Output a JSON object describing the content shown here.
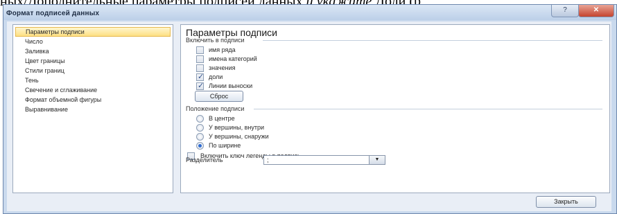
{
  "document": {
    "text_before": "ных/Дополнительные параметры подписей данных ",
    "text_italic": "и укажите",
    "text_after": " Доли (р"
  },
  "window": {
    "title": "Формат подписей данных",
    "help_button": "?",
    "close_button": "✕"
  },
  "sidebar": {
    "items": [
      {
        "label": "Параметры подписи",
        "selected": true
      },
      {
        "label": "Число"
      },
      {
        "label": "Заливка"
      },
      {
        "label": "Цвет границы"
      },
      {
        "label": "Стили границ"
      },
      {
        "label": "Тень"
      },
      {
        "label": "Свечение и сглаживание"
      },
      {
        "label": "Формат объемной фигуры"
      },
      {
        "label": "Выравнивание"
      }
    ]
  },
  "panel": {
    "title": "Параметры подписи",
    "include_section": "Включить в подписи",
    "checkboxes": [
      {
        "label": "имя ряда",
        "checked": false
      },
      {
        "label": "имена категорий",
        "checked": false
      },
      {
        "label": "значения",
        "checked": false
      },
      {
        "label": "доли",
        "checked": true
      },
      {
        "label": "Линии выноски",
        "checked": true
      }
    ],
    "reset_button": "Сброс",
    "position_section": "Положение подписи",
    "radios": [
      {
        "label": "В центре",
        "checked": false
      },
      {
        "label": "У вершины, внутри",
        "checked": false
      },
      {
        "label": "У вершины, снаружи",
        "checked": false
      },
      {
        "label": "По ширине",
        "checked": true
      }
    ],
    "legend_key": {
      "label": "Включить ключ легенды в подпись",
      "checked": false
    },
    "separator": {
      "label": "Разделитель",
      "value": ";",
      "arrow": "▼"
    }
  },
  "footer": {
    "close_button": "Закрыть"
  }
}
